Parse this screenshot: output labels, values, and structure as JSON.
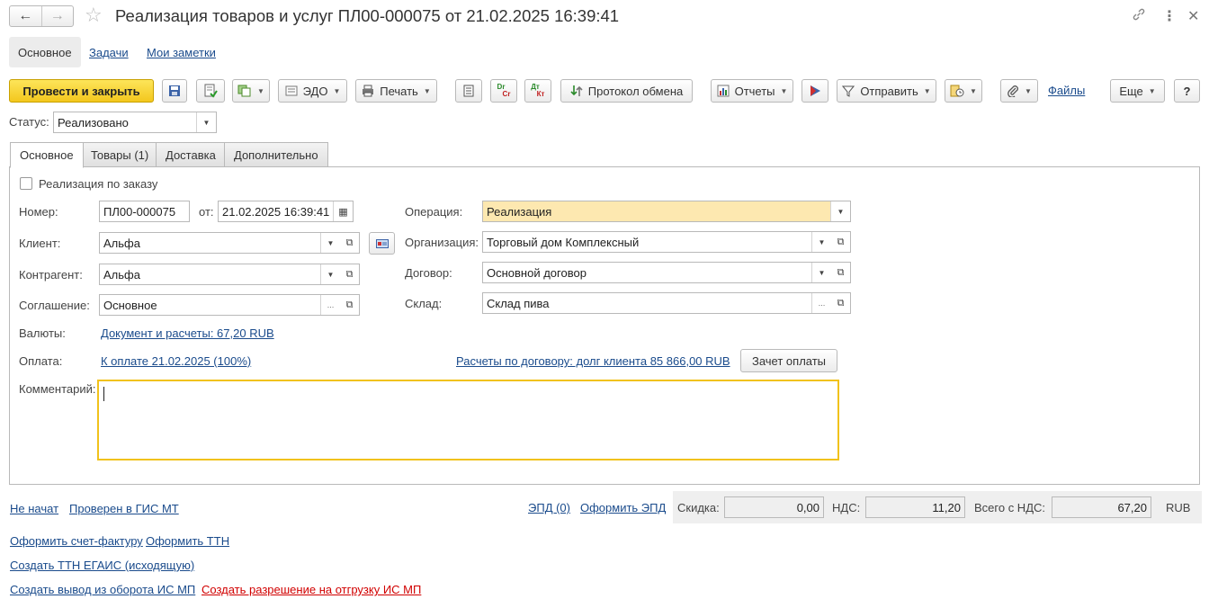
{
  "window": {
    "title": "Реализация товаров и услуг ПЛ00-000075 от 21.02.2025 16:39:41",
    "back_icon": "arrow-left-icon",
    "forward_icon": "arrow-right-icon",
    "favorite_icon": "star-icon",
    "link_icon": "link-icon",
    "more_icon": "kebab-icon",
    "close_icon": "close-icon"
  },
  "section_tabs": [
    {
      "label": "Основное",
      "active": true
    },
    {
      "label": "Задачи",
      "active": false
    },
    {
      "label": "Мои заметки",
      "active": false
    }
  ],
  "toolbar": {
    "post_close": "Провести и закрыть",
    "edo": "ЭДО",
    "print": "Печать",
    "dr_cr_top": "Dr",
    "dr_cr_bottom": "Cr",
    "dt_kt_top": "Дт",
    "dt_kt_bottom": "Кт",
    "exchange_protocol": "Протокол обмена",
    "reports": "Отчеты",
    "send": "Отправить",
    "files": "Файлы",
    "more": "Еще",
    "help": "?"
  },
  "status": {
    "label": "Статус:",
    "value": "Реализовано"
  },
  "doc_tabs": [
    {
      "label": "Основное",
      "active": true
    },
    {
      "label": "Товары (1)",
      "active": false
    },
    {
      "label": "Доставка",
      "active": false
    },
    {
      "label": "Дополнительно",
      "active": false
    }
  ],
  "form": {
    "by_order_label": "Реализация по заказу",
    "by_order_checked": false,
    "number_label": "Номер:",
    "number_value": "ПЛ00-000075",
    "date_label": "от:",
    "date_value": "21.02.2025 16:39:41",
    "client_label": "Клиент:",
    "client_value": "Альфа",
    "counterparty_label": "Контрагент:",
    "counterparty_value": "Альфа",
    "agreement_label": "Соглашение:",
    "agreement_value": "Основное",
    "operation_label": "Операция:",
    "operation_value": "Реализация",
    "organization_label": "Организация:",
    "organization_value": "Торговый дом Комплексный",
    "contract_label": "Договор:",
    "contract_value": "Основной договор",
    "warehouse_label": "Склад:",
    "warehouse_value": "Склад пива",
    "currency_label": "Валюты:",
    "currency_link": "Документ и расчеты: 67,20 RUB",
    "payment_label": "Оплата:",
    "payment_link": "К оплате 21.02.2025 (100%)",
    "settlements_link": "Расчеты по договору: долг клиента 85 866,00 RUB",
    "offset_button": "Зачет оплаты",
    "comment_label": "Комментарий:",
    "comment_value": ""
  },
  "footer": {
    "not_started": "Не начат",
    "gis_checked": "Проверен в ГИС МТ",
    "epd_count": "ЭПД (0)",
    "make_epd": "Оформить ЭПД",
    "discount_label": "Скидка:",
    "discount_value": "0,00",
    "vat_label": "НДС:",
    "vat_value": "11,20",
    "total_label": "Всего с НДС:",
    "total_value": "67,20",
    "currency": "RUB",
    "make_invoice": "Оформить счет-фактуру",
    "make_ttn": "Оформить ТТН",
    "create_egais": "Создать ТТН ЕГАИС (исходящую)",
    "create_withdrawal": "Создать вывод из оборота ИС МП",
    "create_permission": "Создать разрешение на отгрузку ИС МП"
  },
  "colors": {
    "primary_button": "#f3c71d",
    "link": "#1a4b8c",
    "warning_link": "#d10000",
    "operation_highlight": "#fde8b0",
    "comment_focus_border": "#f1c21b"
  }
}
